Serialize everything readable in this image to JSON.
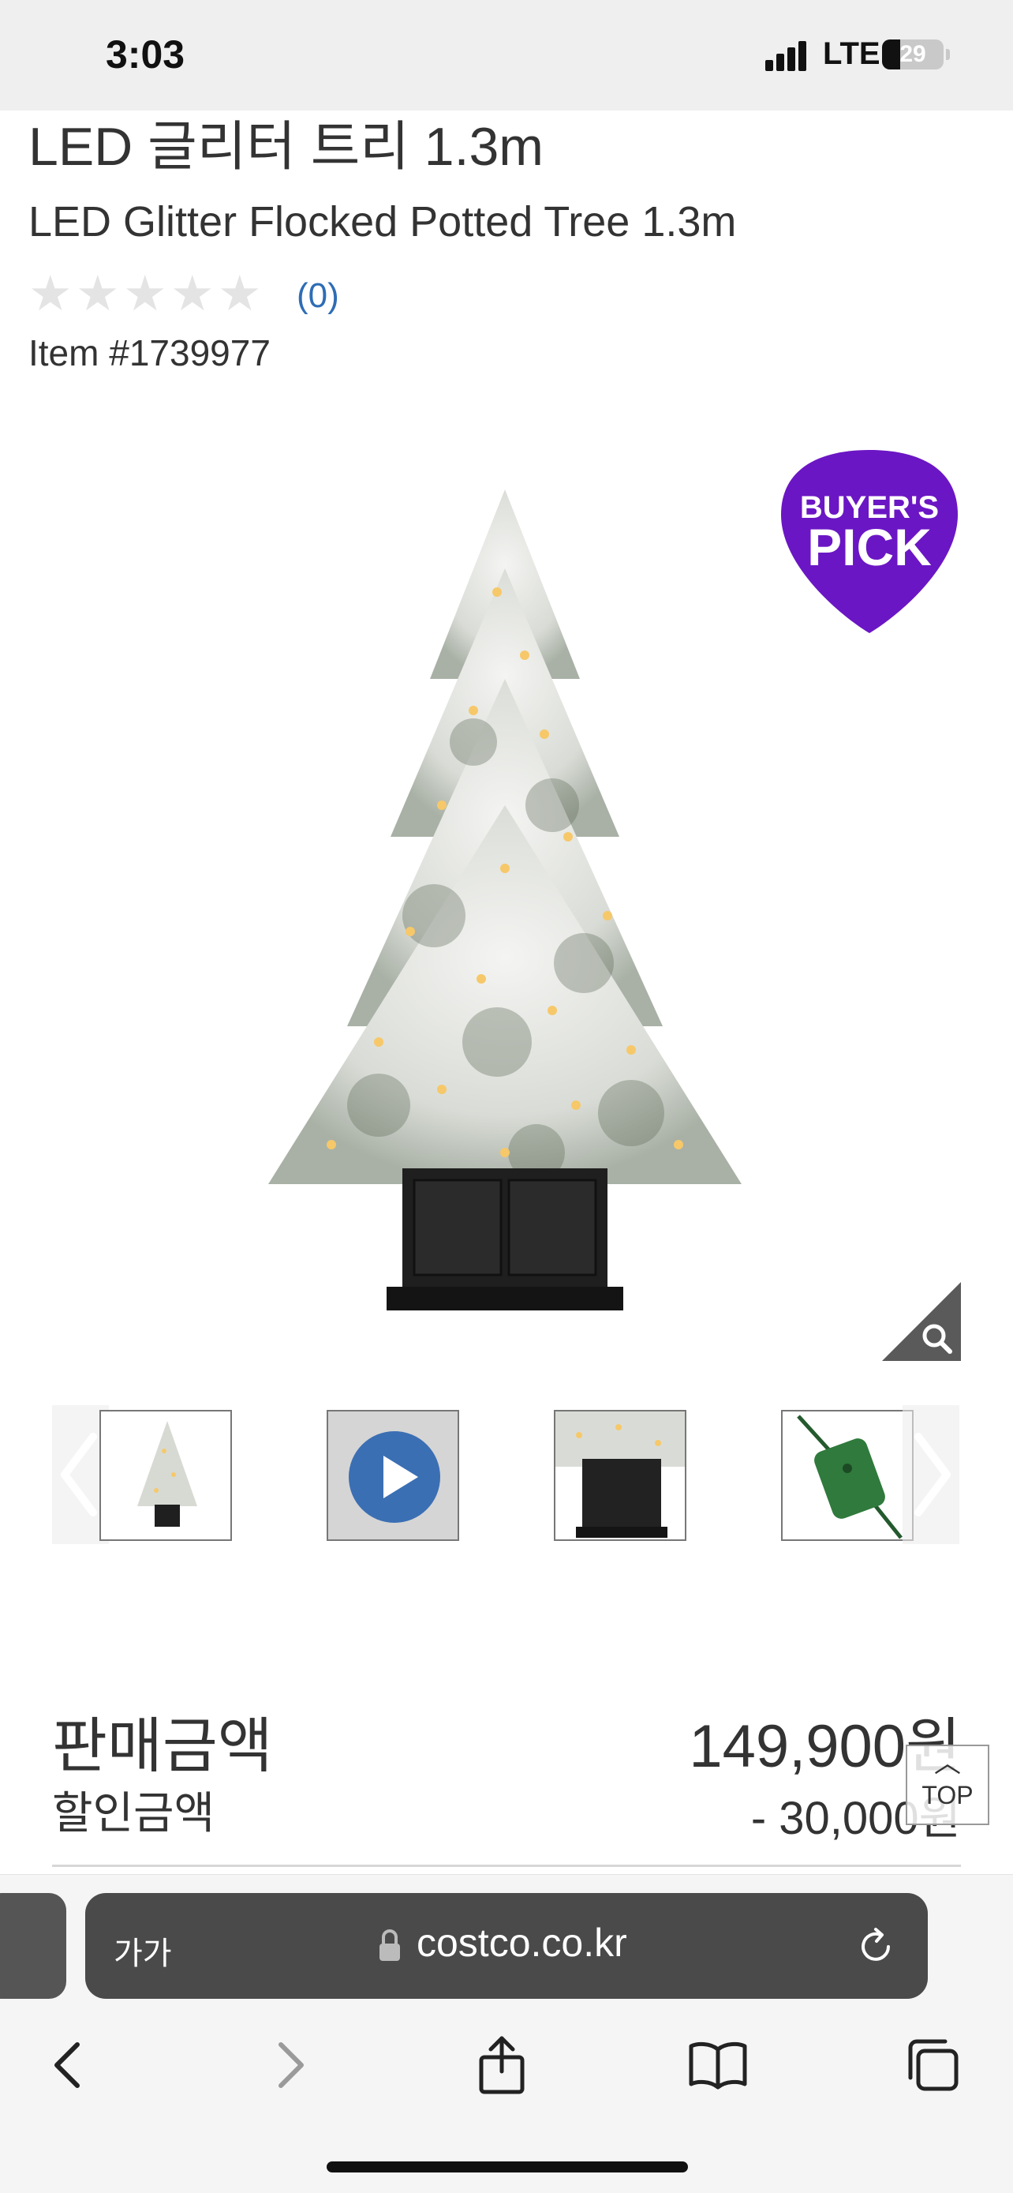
{
  "status_bar": {
    "time": "3:03",
    "network": "LTE",
    "battery_level": "29",
    "signal_bars": 4
  },
  "product": {
    "title_ko": "LED 글리터 트리 1.3m",
    "title_en": "LED Glitter Flocked Potted Tree 1.3m",
    "rating_stars": 0,
    "review_count": "(0)",
    "item_number": "Item #1739977",
    "badge": {
      "line1": "BUYER'S",
      "line2": "PICK",
      "color": "#6b16c4"
    }
  },
  "gallery": {
    "thumbnails": [
      {
        "name": "tree-thumbnail",
        "icon": "tree-photo"
      },
      {
        "name": "video-thumbnail",
        "icon": "play-icon"
      },
      {
        "name": "pot-closeup-thumbnail",
        "icon": "pot-photo"
      },
      {
        "name": "controller-thumbnail",
        "icon": "remote-photo"
      }
    ]
  },
  "pricing": {
    "sale_label": "판매금액",
    "sale_price": "149,900원",
    "discount_label": "할인금액",
    "discount_value": "- 30,000원"
  },
  "top_button": {
    "label": "TOP"
  },
  "browser": {
    "text_size_label": "가가",
    "url": "costco.co.kr"
  },
  "colors": {
    "accent_link": "#2f6db5",
    "badge_purple": "#6b16c4",
    "video_play": "#3b6fb3"
  }
}
